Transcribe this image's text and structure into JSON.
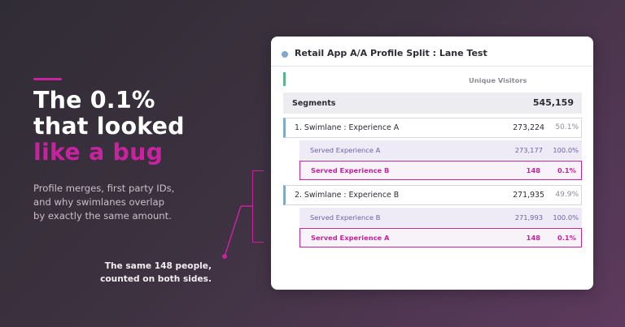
{
  "hero": {
    "title_line1": "The 0.1%",
    "title_line2": "that looked",
    "title_line3": "like a bug",
    "subtitle_line1": "Profile merges, first party IDs,",
    "subtitle_line2": "and why swimlanes overlap",
    "subtitle_line3": "by exactly the same amount."
  },
  "callout": {
    "line1": "The same 148 people,",
    "line2": "counted on both sides."
  },
  "card": {
    "title": "Retail App A/A Profile Split : Lane Test",
    "metric_header": "Unique Visitors",
    "segments_label": "Segments",
    "segments_total": "545,159",
    "groups": [
      {
        "label": "1. Swimlane : Experience A",
        "count": "273,224",
        "pct": "50.1%",
        "served": {
          "label": "Served Experience A",
          "count": "273,177",
          "pct": "100.0%"
        },
        "overlap": {
          "label": "Served Experience B",
          "count": "148",
          "pct": "0.1%"
        }
      },
      {
        "label": "2. Swimlane : Experience B",
        "count": "271,935",
        "pct": "49.9%",
        "served": {
          "label": "Served Experience B",
          "count": "271,993",
          "pct": "100.0%"
        },
        "overlap": {
          "label": "Served Experience A",
          "count": "148",
          "pct": "0.1%"
        }
      }
    ]
  },
  "colors": {
    "accent_pink": "#c7239f",
    "swimlane_blue": "#7fa9cf",
    "metric_green": "#5ab58a",
    "served_purple": "#6e5fa9"
  },
  "icons": {
    "header_dot": "report-dot-icon"
  }
}
